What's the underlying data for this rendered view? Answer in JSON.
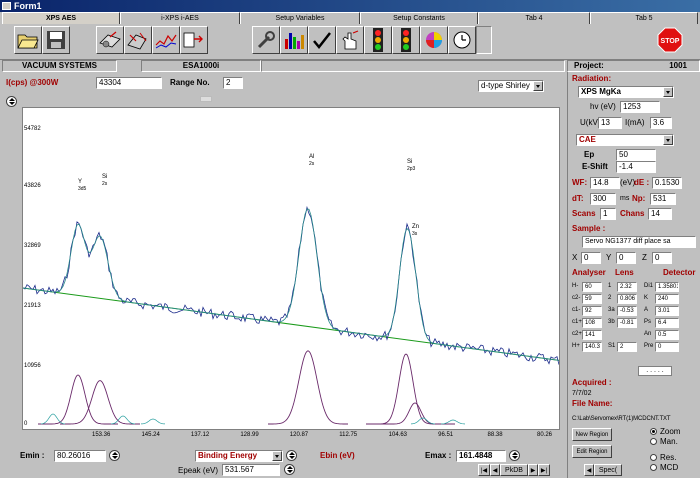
{
  "window": {
    "title": "Form1"
  },
  "tabs": [
    "XPS AES",
    "i-XPS i-AES",
    "Setup Variables",
    "Setup Constants",
    "Tab 4",
    "Tab 5"
  ],
  "toolbar": {
    "icons": [
      "folder-open-icon",
      "save-disk-icon",
      "spectrometer-icon",
      "scan-icon",
      "line-plot-icon",
      "import-icon",
      "wrench-icon",
      "bar-chart-icon",
      "checkmark-icon",
      "hand-pointer-icon",
      "traffic-light-icon",
      "traffic-light-icon",
      "color-wheel-icon",
      "clock-icon",
      "stop-icon"
    ],
    "stop_label": "STOP"
  },
  "info": {
    "company": "VACUUM SYSTEMS",
    "model": "ESA1000i",
    "project_label": "Project:",
    "project_value": "1001"
  },
  "header_row": {
    "intensity_label": "I(cps) @300W",
    "intensity_value": "43304",
    "range_label": "Range No.",
    "range_value": "2",
    "background_type": "d-type Shirley"
  },
  "plot": {
    "y_ticks": [
      "54782",
      "43826",
      "32869",
      "21913",
      "10956",
      "0"
    ],
    "x_ticks": [
      "153.36",
      "145.24",
      "137.12",
      "128.99",
      "120.87",
      "112.75",
      "104.63",
      "96.51",
      "88.38",
      "80.26"
    ],
    "peak_labels": [
      {
        "l1": "Y",
        "l2": "3d5"
      },
      {
        "l1": "Si",
        "l2": "2s"
      },
      {
        "l1": "Al",
        "l2": "2s"
      },
      {
        "l1": "Si",
        "l2": "2p3"
      },
      {
        "l1": "Zn",
        "l2": "3s"
      }
    ]
  },
  "bottom": {
    "emin_label": "Emin :",
    "emin_value": "80.26016",
    "mode_value": "Binding Energy",
    "ebin_label": "Ebin  (eV)",
    "emax_label": "Emax :",
    "emax_value": "161.4848",
    "epeak_label": "Epeak (eV)",
    "epeak_value": "531.567",
    "pkdb_label": "PkDB"
  },
  "right": {
    "radiation_label": "Radiation:",
    "radiation_value": "XPS MgKa",
    "hv_label": "hv (eV)",
    "hv_value": "1253",
    "u_label": "U(kV)",
    "u_value": "13",
    "i_label": "I(mA)",
    "i_value": "3.6",
    "mode_value": "CAE",
    "ep_label": "Ep",
    "ep_value": "50",
    "eshift_label": "E-Shift",
    "eshift_value": "-1.4",
    "wf_label": "WF:",
    "wf_value": "14.8",
    "wf_unit": "(eV)",
    "de_label": "dE :",
    "de_value": "0.1530",
    "dt_label": "dT:",
    "dt_value": "300",
    "dt_unit": "ms",
    "np_label": "Np:",
    "np_value": "531",
    "scans_label": "Scans",
    "scans_value": "1",
    "chans_label": "Chans",
    "chans_value": "14",
    "sample_label": "Sample :",
    "sample_value": "Servo NG1377 diff place sa",
    "x_label": "X",
    "x_value": "0",
    "y_label": "Y",
    "y_value": "0",
    "z_label": "Z",
    "z_value": "0",
    "col_headers": [
      "Analyser",
      "Lens",
      "Detector"
    ],
    "analyser": [
      {
        "k": "H-",
        "v": "60"
      },
      {
        "k": "c2-",
        "v": "59"
      },
      {
        "k": "c1-",
        "v": "92"
      },
      {
        "k": "c1+",
        "v": "108"
      },
      {
        "k": "c2+",
        "v": "141"
      },
      {
        "k": "H+",
        "v": "140.3"
      }
    ],
    "lens": [
      {
        "k": "1",
        "v": "2.32"
      },
      {
        "k": "2",
        "v": "0.806"
      },
      {
        "k": "3a",
        "v": "-0.53"
      },
      {
        "k": "3b",
        "v": "-0.81"
      },
      {
        "k": "",
        "v": ""
      },
      {
        "k": "S1",
        "v": "2"
      }
    ],
    "detector": [
      {
        "k": "Di1",
        "v": "1.35801"
      },
      {
        "k": "K",
        "v": "240"
      },
      {
        "k": "A",
        "v": "3.01"
      },
      {
        "k": "Ps",
        "v": "6.4"
      },
      {
        "k": "An",
        "v": "0.5"
      },
      {
        "k": "Pre",
        "v": "0"
      }
    ],
    "dots": ". . . . .",
    "acquired_label": "Acquired :",
    "acquired_value": "7/7/02",
    "filename_label": "File Name:",
    "filename_value": "C:\\Lab\\Servomex\\RT(1)MCDCNT.TXT",
    "new_region": "New Region",
    "edit_region": "Edit Region",
    "radios": [
      "Zoom",
      "Man.",
      "Res.",
      "MCD"
    ],
    "spec_label": "Spec("
  },
  "colors": {
    "spectrum": "#1a2a8a",
    "background_line": "#1a9a1a",
    "fit": "#2a8a8a",
    "component": "#6a2a6a",
    "label_red": "#a00000"
  }
}
